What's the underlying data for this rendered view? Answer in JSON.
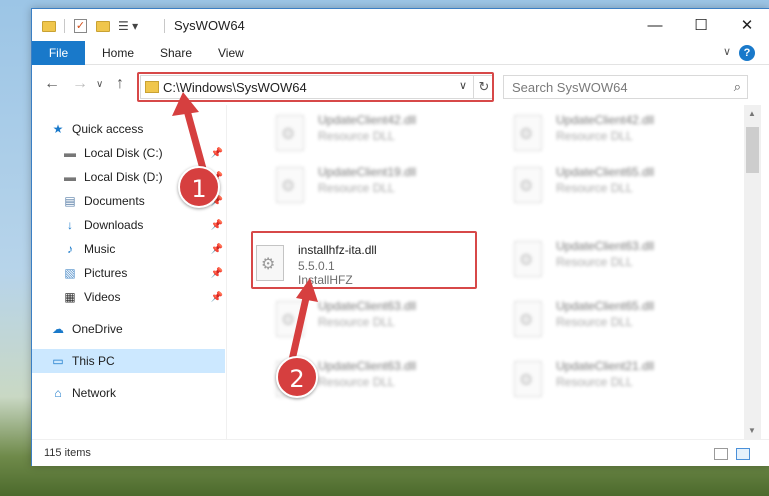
{
  "window": {
    "title": "SysWOW64",
    "minimize_glyph": "—",
    "maximize_glyph": "☐",
    "close_glyph": "✕"
  },
  "ribbon": {
    "file": "File",
    "tabs": [
      "Home",
      "Share",
      "View"
    ],
    "help": "?",
    "collapse": "∨"
  },
  "nav": {
    "back": "←",
    "forward": "→",
    "recent": "∨",
    "up": "↑"
  },
  "address": {
    "path": "C:\\Windows\\SysWOW64",
    "dropdown": "∨",
    "refresh": "↻"
  },
  "search": {
    "placeholder": "Search SysWOW64",
    "icon": "⌕"
  },
  "sidebar": {
    "items": [
      {
        "label": "Quick access",
        "icon": "star-icon",
        "glyph": "★"
      },
      {
        "label": "Local Disk (C:)",
        "icon": "drive-icon",
        "glyph": "▬"
      },
      {
        "label": "Local Disk (D:)",
        "icon": "drive-icon",
        "glyph": "▬"
      },
      {
        "label": "Documents",
        "icon": "documents-icon",
        "glyph": "▤"
      },
      {
        "label": "Downloads",
        "icon": "download-icon",
        "glyph": "↓"
      },
      {
        "label": "Music",
        "icon": "music-icon",
        "glyph": "♪"
      },
      {
        "label": "Pictures",
        "icon": "pictures-icon",
        "glyph": "▧"
      },
      {
        "label": "Videos",
        "icon": "videos-icon",
        "glyph": "▦"
      },
      {
        "label": "OneDrive",
        "icon": "cloud-icon",
        "glyph": "☁"
      },
      {
        "label": "This PC",
        "icon": "computer-icon",
        "glyph": "▭"
      },
      {
        "label": "Network",
        "icon": "network-icon",
        "glyph": "⌂"
      }
    ],
    "pin_glyph": "📌"
  },
  "files": [
    {
      "name": "UpdateClient42.dll",
      "desc": "Resource DLL"
    },
    {
      "name": "UpdateClient42.dll",
      "desc": "Resource DLL"
    },
    {
      "name": "UpdateClient19.dll",
      "desc": "Resource DLL"
    },
    {
      "name": "UpdateClient65.dll",
      "desc": "Resource DLL"
    },
    {
      "name": "UpdateClient63.dll",
      "desc": "Resource DLL"
    },
    {
      "name": "UpdateClient63.dll",
      "desc": "Resource DLL"
    },
    {
      "name": "UpdateClient65.dll",
      "desc": "Resource DLL"
    },
    {
      "name": "UpdateClient63.dll",
      "desc": "Resource DLL"
    },
    {
      "name": "UpdateClient21.dll",
      "desc": "Resource DLL"
    }
  ],
  "highlighted_file": {
    "name": "installhfz-ita.dll",
    "version": "5.5.0.1",
    "desc": "InstallHFZ"
  },
  "status": {
    "count": "115 items"
  },
  "callouts": {
    "one": "1",
    "two": "2"
  },
  "colors": {
    "accent": "#1979ca",
    "highlight": "#d74848",
    "selected": "#cce8ff"
  }
}
